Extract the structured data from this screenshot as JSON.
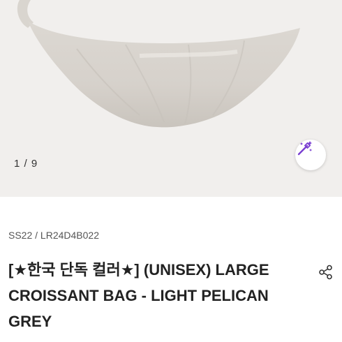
{
  "gallery": {
    "counter": "1 / 9",
    "magic_icon": "magic-wand-icon",
    "accent_color": "#7a3fd1"
  },
  "product": {
    "meta": "SS22 / LR24D4B022",
    "title": "[★한국 단독 컬러★] (UNISEX) LARGE CROISSANT BAG - LIGHT PELICAN GREY",
    "share_icon": "share-icon"
  }
}
